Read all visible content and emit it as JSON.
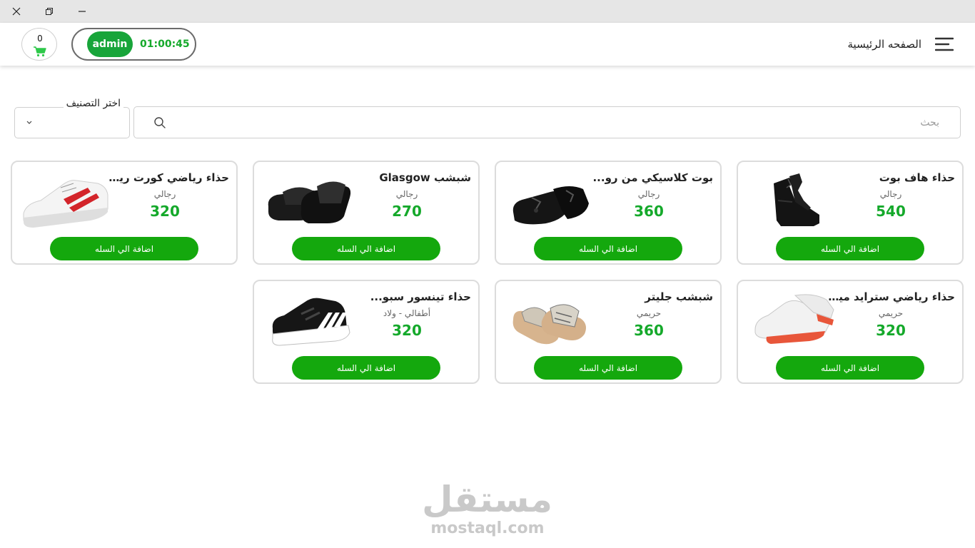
{
  "window": {
    "close_icon": "close-icon",
    "restore_icon": "restore-icon",
    "minimize_icon": "minimize-icon"
  },
  "header": {
    "cart_count": "0",
    "user": "admin",
    "session_timer": "01:00:45",
    "nav_title": "الصفحه الرئيسية",
    "accent_color": "#15a92b"
  },
  "filters": {
    "category_label": "اختر التصنيف",
    "search_placeholder": "بحث"
  },
  "add_to_cart_label": "اضافة الي السله",
  "products": [
    {
      "name": "حذاء هاف بوت",
      "category": "رجالي",
      "price": "540",
      "image": "black-half-boot"
    },
    {
      "name": "بوت  كلاسيكي من رو...",
      "category": "رجالي",
      "price": "360",
      "image": "black-tassel-loafer"
    },
    {
      "name": "شبشب Glasgow",
      "category": "رجالي",
      "price": "270",
      "image": "black-slide-sandal"
    },
    {
      "name": "حذاء رياضي كورت ريت...",
      "category": "رجالي",
      "price": "320",
      "image": "white-red-sneaker"
    },
    {
      "name": "حذاء رياضي سترايد  مينترا",
      "category": "حريمي",
      "price": "320",
      "image": "white-orange-sneaker"
    },
    {
      "name": "شبشب جليتر",
      "category": "حريمي",
      "price": "360",
      "image": "glitter-slide-sandal"
    },
    {
      "name": "حذاء تينسور سبو...",
      "category": "أطفالي - ولاد",
      "price": "320",
      "image": "black-white-stripe-sneaker"
    }
  ],
  "watermark": {
    "arabic": "مستقل",
    "latin": "mostaql.com"
  }
}
